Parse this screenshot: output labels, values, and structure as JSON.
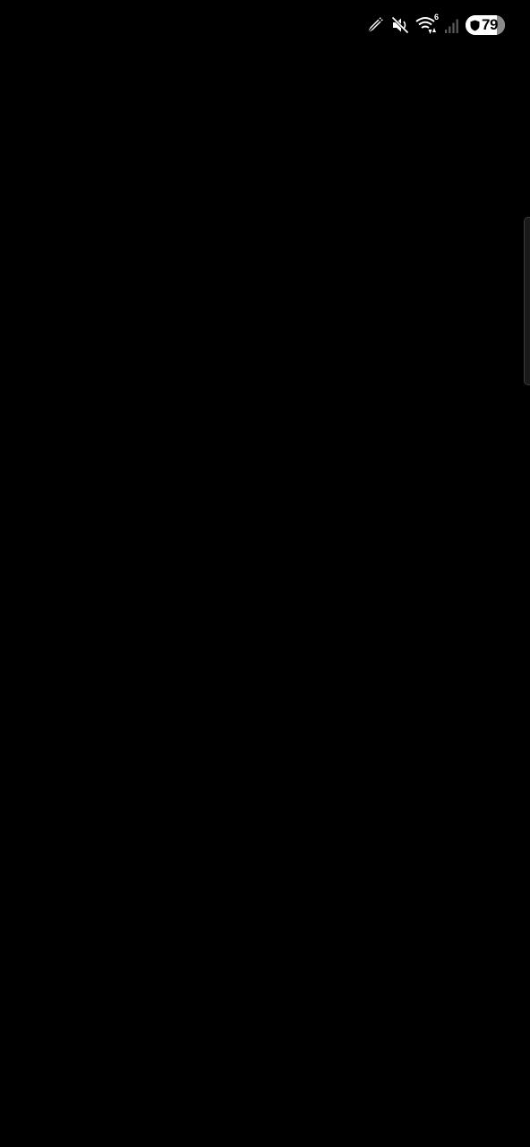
{
  "status_bar": {
    "icons": [
      "edit-pen-icon",
      "muted-speaker-icon",
      "wifi-data-icon",
      "cellular-signal-icon"
    ],
    "wifi_badge": "6",
    "battery": {
      "level": "79",
      "fraction": 0.79,
      "shield_icon": "shield-icon"
    }
  },
  "colors": {
    "background": "#000000",
    "icon": "#ffffff",
    "battery_empty": "#8a8a8a",
    "signal_dim": "#5a5a5a",
    "edge_handle": "#1a1a1a"
  },
  "edge_panel": {
    "icon": "edge-panel-handle"
  }
}
